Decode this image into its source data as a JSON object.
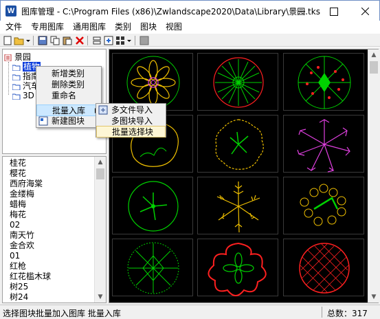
{
  "window": {
    "title": "图库管理 - C:\\Program Files (x86)\\Zwlandscape2020\\Data\\Library\\景园.tks",
    "app_icon_text": "W",
    "minimize": "—",
    "maximize": "☐",
    "close": "✕"
  },
  "menubar": {
    "items": [
      "文件",
      "专用图库",
      "通用图库",
      "类别",
      "图块",
      "视图"
    ]
  },
  "toolbar": {
    "icons": [
      "new-file-icon",
      "open-folder-icon",
      "dropdown-arrow-icon",
      "save-icon",
      "copy-icon",
      "paste-icon",
      "delete-icon",
      "import-icon",
      "export-icon",
      "view-mode-icon",
      "dropdown-arrow-icon",
      "properties-icon"
    ]
  },
  "tree": {
    "root": "景园",
    "nodes": [
      {
        "label": "植物",
        "selected": true
      },
      {
        "label": "指南",
        "selected": false
      },
      {
        "label": "汽车",
        "selected": false
      },
      {
        "label": "3D",
        "selected": false
      }
    ]
  },
  "list": {
    "items": [
      "桂花",
      "樱花",
      "西府海棠",
      "金缕梅",
      "蜡梅",
      "梅花",
      "02",
      "南天竹",
      "金合欢",
      "01",
      "红枪",
      "红花槛木球",
      "树25",
      "树24"
    ]
  },
  "context_menu": {
    "items": [
      "新增类别",
      "删除类别",
      "重命名",
      "批量入库",
      "新建图块"
    ]
  },
  "submenu": {
    "items": [
      "多文件导入",
      "多图块导入",
      "批量选择块"
    ]
  },
  "statusbar": {
    "message": "选择图块批量加入图库 批量入库",
    "count_label": "总数：",
    "count_value": "317"
  },
  "colors": {
    "preview_bg": "#000000",
    "green": "#00d200",
    "yellow": "#f0c000",
    "magenta": "#e040e0",
    "red": "#ff2020",
    "selection": "#0a3cdc"
  }
}
